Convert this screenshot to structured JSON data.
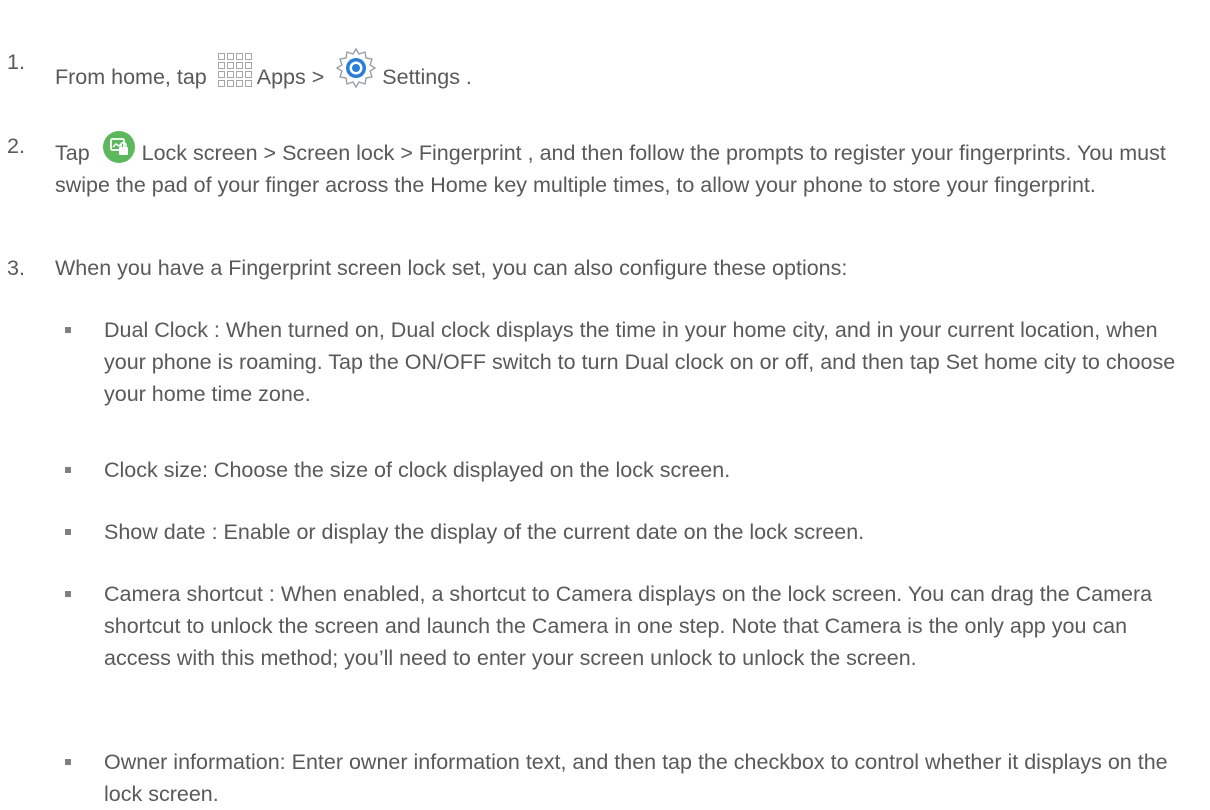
{
  "steps": [
    {
      "number": "1.",
      "text_before_apps": "From home, tap ",
      "apps_label": "Apps",
      "sep": " > ",
      "settings_label": "Settings ."
    },
    {
      "number": "2.",
      "text_before_icon": "Tap ",
      "text": "Lock screen  > Screen lock  > Fingerprint , and then follow the prompts to register your fingerprints. You must swipe the pad of your finger across the Home key multiple times, to allow your phone to store your fingerprint."
    },
    {
      "number": "3.",
      "text": "When you have a Fingerprint screen lock set, you can also configure these options:"
    }
  ],
  "bullets": [
    "Dual Clock : When turned on, Dual clock displays the time in your home city, and in your current location, when your phone is roaming. Tap the ON/OFF switch to turn Dual clock on or off, and then tap Set home city  to choose your home time zone.",
    "Clock size:  Choose the size of clock displayed on the lock screen.",
    "Show date : Enable or display the display of the current date on the lock screen.",
    "Camera shortcut  : When enabled, a shortcut to Camera displays on the lock screen. You can drag the Camera shortcut to unlock the screen and launch the Camera in one step. Note that Camera is the only app you can access with this method; you’ll need to enter your screen unlock to unlock the screen.",
    "Owner information:   Enter owner information text, and then tap the checkbox to control whether it displays on the lock screen."
  ],
  "icons": {
    "apps": "apps-grid-icon",
    "settings": "settings-gear-icon",
    "lock_screen": "lock-screen-icon"
  },
  "colors": {
    "text": "#595959",
    "lock_icon": "#5cb85c"
  }
}
